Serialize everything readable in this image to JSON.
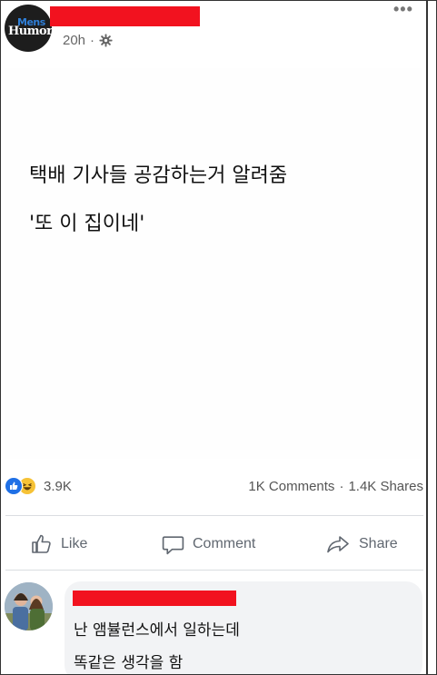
{
  "post": {
    "page_logo": {
      "line1": "Mens",
      "line2": "Humor"
    },
    "timestamp": "20h",
    "separator": "·",
    "icons": {
      "privacy": "gear-icon",
      "more": "more-options-icon"
    },
    "menu_glyph": "•••",
    "text_lines": [
      "택배 기사들 공감하는거 알려줌",
      "'또 이 집이네'"
    ]
  },
  "stats": {
    "reaction_count": "3.9K",
    "comments": "1K Comments",
    "dot": "·",
    "shares": "1.4K Shares",
    "reaction_icons": [
      "like-reaction-icon",
      "haha-reaction-icon"
    ]
  },
  "actions": {
    "like": "Like",
    "comment": "Comment",
    "share": "Share"
  },
  "comment": {
    "lines": [
      "난 앰뷸런스에서 일하는데",
      "똑같은 생각을 함"
    ]
  },
  "colors": {
    "redaction": "#f2121f",
    "reaction_like": "#1f70e6",
    "reaction_haha": "#f6c236",
    "secondary_text": "#606770",
    "comment_bubble": "#f2f3f5"
  }
}
